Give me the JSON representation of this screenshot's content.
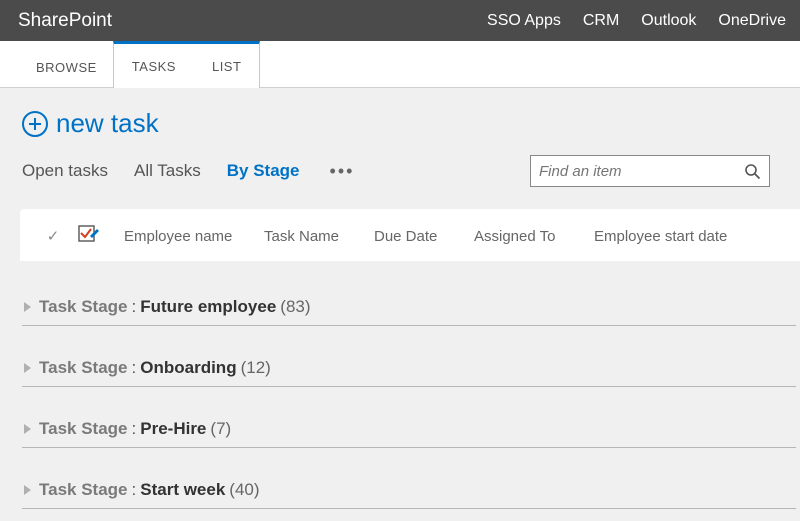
{
  "topbar": {
    "brand": "SharePoint",
    "links": [
      "SSO Apps",
      "CRM",
      "Outlook",
      "OneDrive"
    ]
  },
  "ribbon": {
    "tabs": [
      "BROWSE",
      "TASKS",
      "LIST"
    ],
    "active_group_start": 1
  },
  "newtask_label": "new task",
  "views": {
    "items": [
      "Open tasks",
      "All Tasks",
      "By Stage"
    ],
    "active_index": 2,
    "more": "•••"
  },
  "search": {
    "placeholder": "Find an item"
  },
  "columns": [
    "Employee name",
    "Task Name",
    "Due Date",
    "Assigned To",
    "Employee start date"
  ],
  "group_label": "Task Stage",
  "groups": [
    {
      "name": "Future employee",
      "count": 83
    },
    {
      "name": "Onboarding",
      "count": 12
    },
    {
      "name": "Pre-Hire",
      "count": 7
    },
    {
      "name": "Start week",
      "count": 40
    }
  ]
}
